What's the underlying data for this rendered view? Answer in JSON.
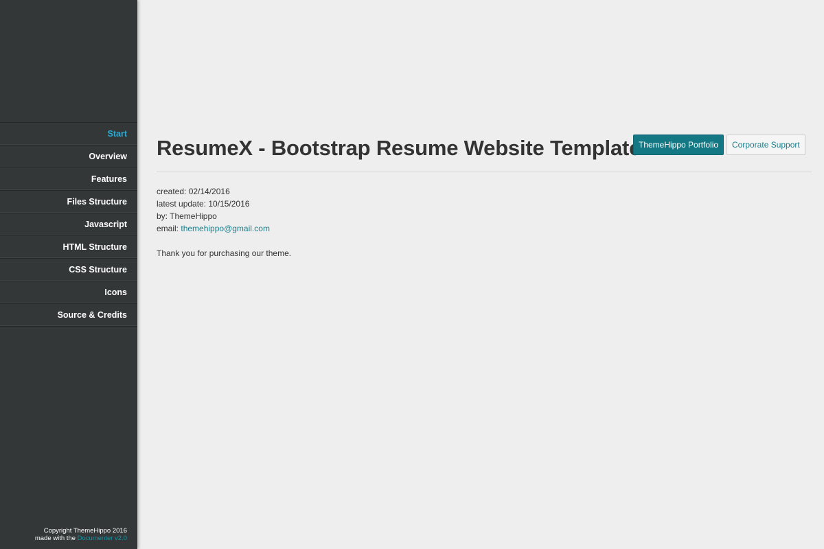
{
  "sidebar": {
    "items": [
      {
        "label": "Start",
        "active": true
      },
      {
        "label": "Overview"
      },
      {
        "label": "Features"
      },
      {
        "label": "Files Structure"
      },
      {
        "label": "Javascript"
      },
      {
        "label": "HTML Structure"
      },
      {
        "label": "CSS Structure"
      },
      {
        "label": "Icons"
      },
      {
        "label": "Source & Credits"
      }
    ],
    "footer": {
      "copyright": "Copyright ThemeHippo 2016",
      "made_with": "made with the",
      "link_text": "Documenter v2.0"
    }
  },
  "main": {
    "title": "ResumeX - Bootstrap Resume Website Template",
    "buttons": {
      "portfolio": "ThemeHippo Portfolio",
      "support": "Corporate Support"
    },
    "meta": {
      "created": "created: 02/14/2016",
      "updated": "latest update: 10/15/2016",
      "by": "by: ThemeHippo",
      "email_label": "email:",
      "email": "themehippo@gmail.com"
    },
    "thanks": "Thank you for purchasing our theme."
  },
  "colors": {
    "sidebar_bg": "#343738",
    "page_bg": "#eeeeee",
    "active_nav": "#2aa9d2",
    "accent": "#137883",
    "link": "#1a7e8a"
  }
}
